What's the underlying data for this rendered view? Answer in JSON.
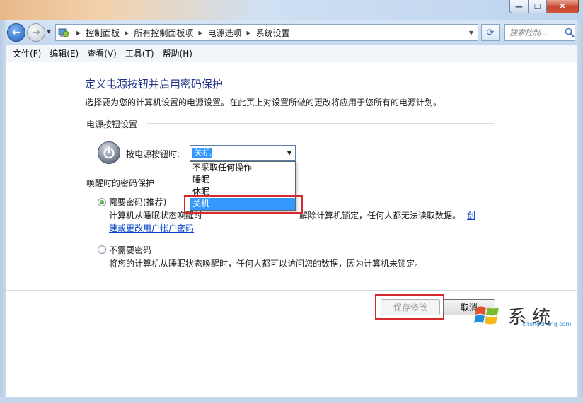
{
  "window": {
    "minimize_glyph": "—",
    "maximize_glyph": "☐",
    "close_glyph": "✕"
  },
  "nav": {
    "back_glyph": "←",
    "forward_glyph": "→",
    "breadcrumbs": [
      "控制面板",
      "所有控制面板项",
      "电源选项",
      "系统设置"
    ],
    "refresh_glyph": "⟳",
    "search_placeholder": "搜索控制..."
  },
  "menu": {
    "items": [
      "文件(F)",
      "编辑(E)",
      "查看(V)",
      "工具(T)",
      "帮助(H)"
    ]
  },
  "page": {
    "title": "定义电源按钮并启用密码保护",
    "description": "选择要为您的计算机设置的电源设置。在此页上对设置所做的更改将应用于您所有的电源计划。",
    "power_section": {
      "heading": "电源按钮设置",
      "label": "按电源按钮时:",
      "selected_value": "关机",
      "options": [
        "不采取任何操作",
        "睡眠",
        "休眠",
        "关机"
      ],
      "highlighted_option": "关机"
    },
    "password_section": {
      "heading": "唤醒时的密码保护",
      "option_require": {
        "label": "需要密码(推荐)",
        "checked": true,
        "desc_line1_left": "计算机从睡眠状态唤醒时",
        "desc_line1_right": "解除计算机锁定，任何人都无法读取数据。",
        "link_part1": "创",
        "link_part2": "建或更改用户帐户密码"
      },
      "option_no_require": {
        "label": "不需要密码",
        "checked": false,
        "desc": "将您的计算机从睡眠状态唤醒时，任何人都可以访问您的数据，因为计算机未锁定。"
      }
    },
    "buttons": {
      "save": "保存修改",
      "cancel": "取消"
    }
  },
  "watermark": {
    "text": "系统",
    "subtext": "xitongcheng.com"
  },
  "colors": {
    "title_blue": "#1e3287",
    "highlight_blue": "#3399ff",
    "annotation_red": "#d6292e",
    "link_blue": "#0645c8"
  }
}
